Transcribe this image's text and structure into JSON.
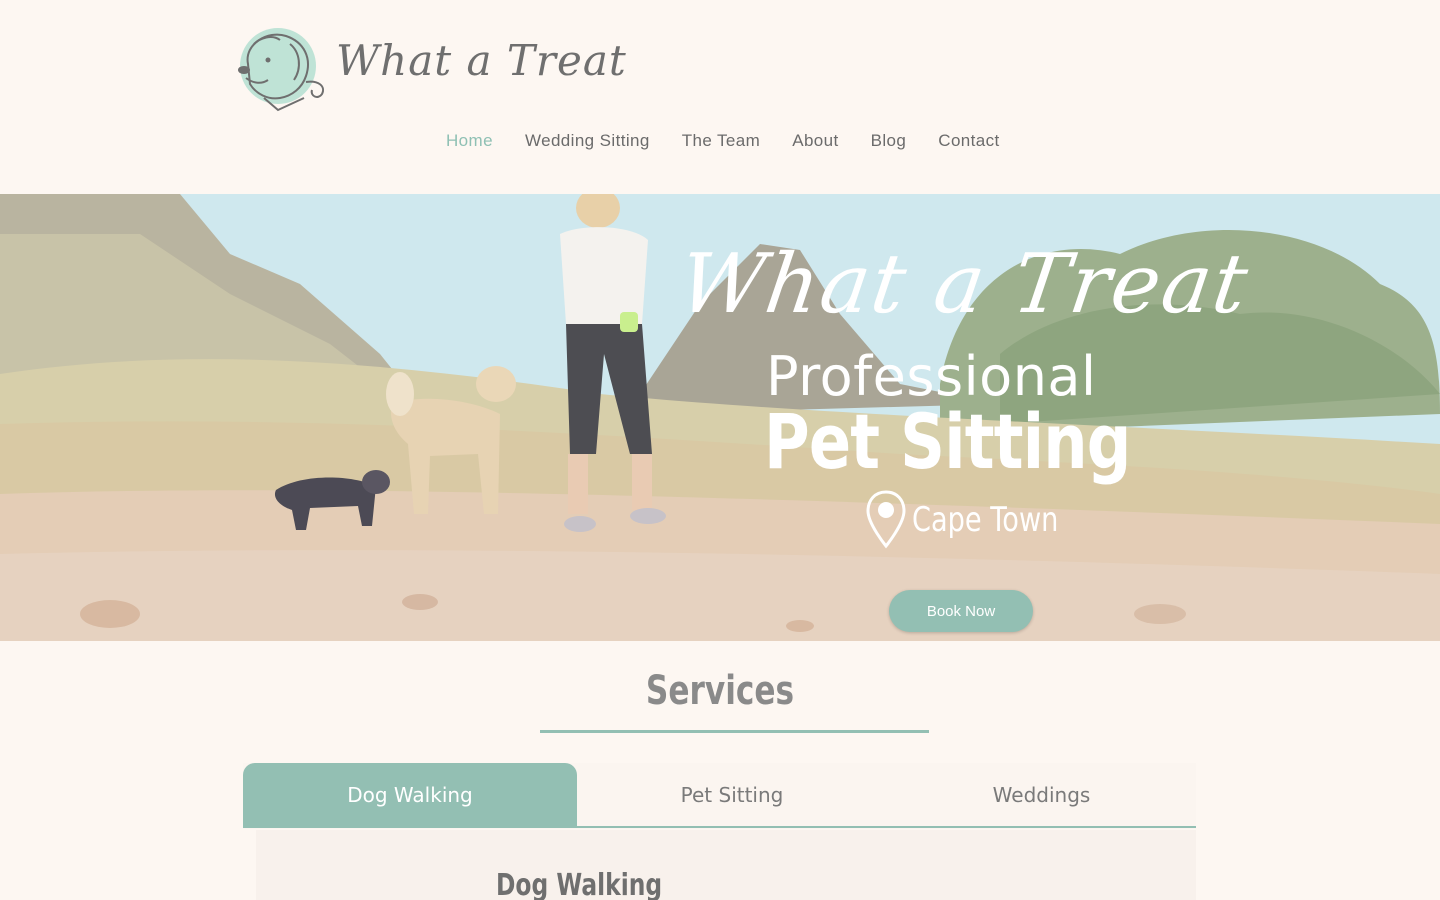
{
  "brand": {
    "name": "What a Treat",
    "logo_icon": "dog-head-icon"
  },
  "nav": {
    "items": [
      {
        "label": "Home",
        "active": true
      },
      {
        "label": "Wedding Sitting",
        "active": false
      },
      {
        "label": "The Team",
        "active": false
      },
      {
        "label": "About",
        "active": false
      },
      {
        "label": "Blog",
        "active": false
      },
      {
        "label": "Contact",
        "active": false
      }
    ]
  },
  "hero": {
    "script_title": "What a Treat",
    "line1": "Professional",
    "line2": "Pet Sitting",
    "location_icon": "map-pin-icon",
    "location": "Cape Town",
    "cta_label": "Book Now"
  },
  "services": {
    "title": "Services",
    "tabs": [
      {
        "label": "Dog Walking",
        "active": true
      },
      {
        "label": "Pet Sitting",
        "active": false
      },
      {
        "label": "Weddings",
        "active": false
      }
    ],
    "panel_heading": "Dog Walking"
  },
  "colors": {
    "accent": "#93bfb3",
    "background": "#fdf7f2",
    "nav_active": "#8fc0b4",
    "text": "#6b6b6b"
  }
}
